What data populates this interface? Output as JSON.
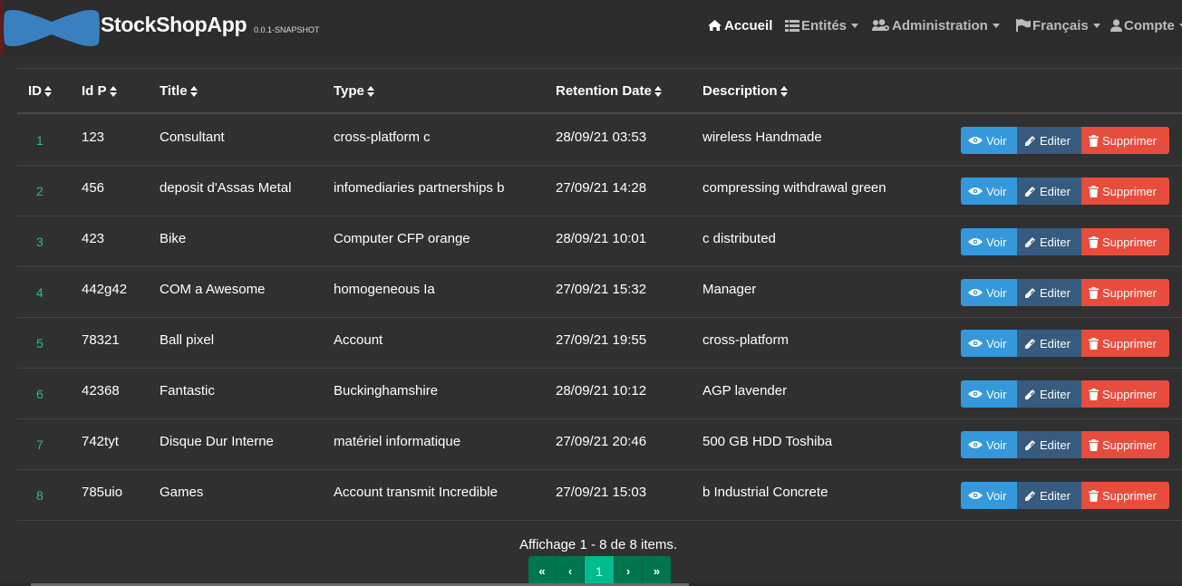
{
  "app": {
    "title": "StockShopApp",
    "version": "0.0.1-SNAPSHOT"
  },
  "nav": {
    "home": "Accueil",
    "entities": "Entités",
    "admin": "Administration",
    "language": "Français",
    "account": "Compte"
  },
  "table": {
    "headers": [
      "ID",
      "Id P",
      "Title",
      "Type",
      "Retention Date",
      "Description"
    ],
    "rows": [
      {
        "id": "1",
        "idp": "123",
        "title": "Consultant",
        "type": "cross-platform c",
        "date": "28/09/21 03:53",
        "desc": "wireless Handmade"
      },
      {
        "id": "2",
        "idp": "456",
        "title": "deposit d'Assas Metal",
        "type": "infomediaries partnerships b",
        "date": "27/09/21 14:28",
        "desc": "compressing withdrawal green"
      },
      {
        "id": "3",
        "idp": "423",
        "title": "Bike",
        "type": "Computer CFP orange",
        "date": "28/09/21 10:01",
        "desc": "c distributed"
      },
      {
        "id": "4",
        "idp": "442g42",
        "title": "COM a Awesome",
        "type": "homogeneous Ia",
        "date": "27/09/21 15:32",
        "desc": "Manager"
      },
      {
        "id": "5",
        "idp": "78321",
        "title": "Ball pixel",
        "type": "Account",
        "date": "27/09/21 19:55",
        "desc": "cross-platform"
      },
      {
        "id": "6",
        "idp": "42368",
        "title": "Fantastic",
        "type": "Buckinghamshire",
        "date": "28/09/21 10:12",
        "desc": "AGP lavender"
      },
      {
        "id": "7",
        "idp": "742tyt",
        "title": "Disque Dur Interne",
        "type": "matériel informatique",
        "date": "27/09/21 20:46",
        "desc": "500 GB HDD Toshiba"
      },
      {
        "id": "8",
        "idp": "785uio",
        "title": "Games",
        "type": "Account transmit Incredible",
        "date": "27/09/21 15:03",
        "desc": "b Industrial Concrete"
      }
    ],
    "actions": {
      "view": "Voir",
      "edit": "Editer",
      "delete": "Supprimer"
    }
  },
  "footer": {
    "summary": "Affichage 1 - 8 de 8 items.",
    "pagination": [
      "«",
      "‹",
      "1",
      "›",
      "»"
    ],
    "current_page": "1"
  },
  "colors": {
    "background": "#303030",
    "primary_blue": "#3498db",
    "edit_blue": "#375a7f",
    "danger": "#e74c3c",
    "success": "#00bc8c",
    "id_link": "#27c07d"
  }
}
